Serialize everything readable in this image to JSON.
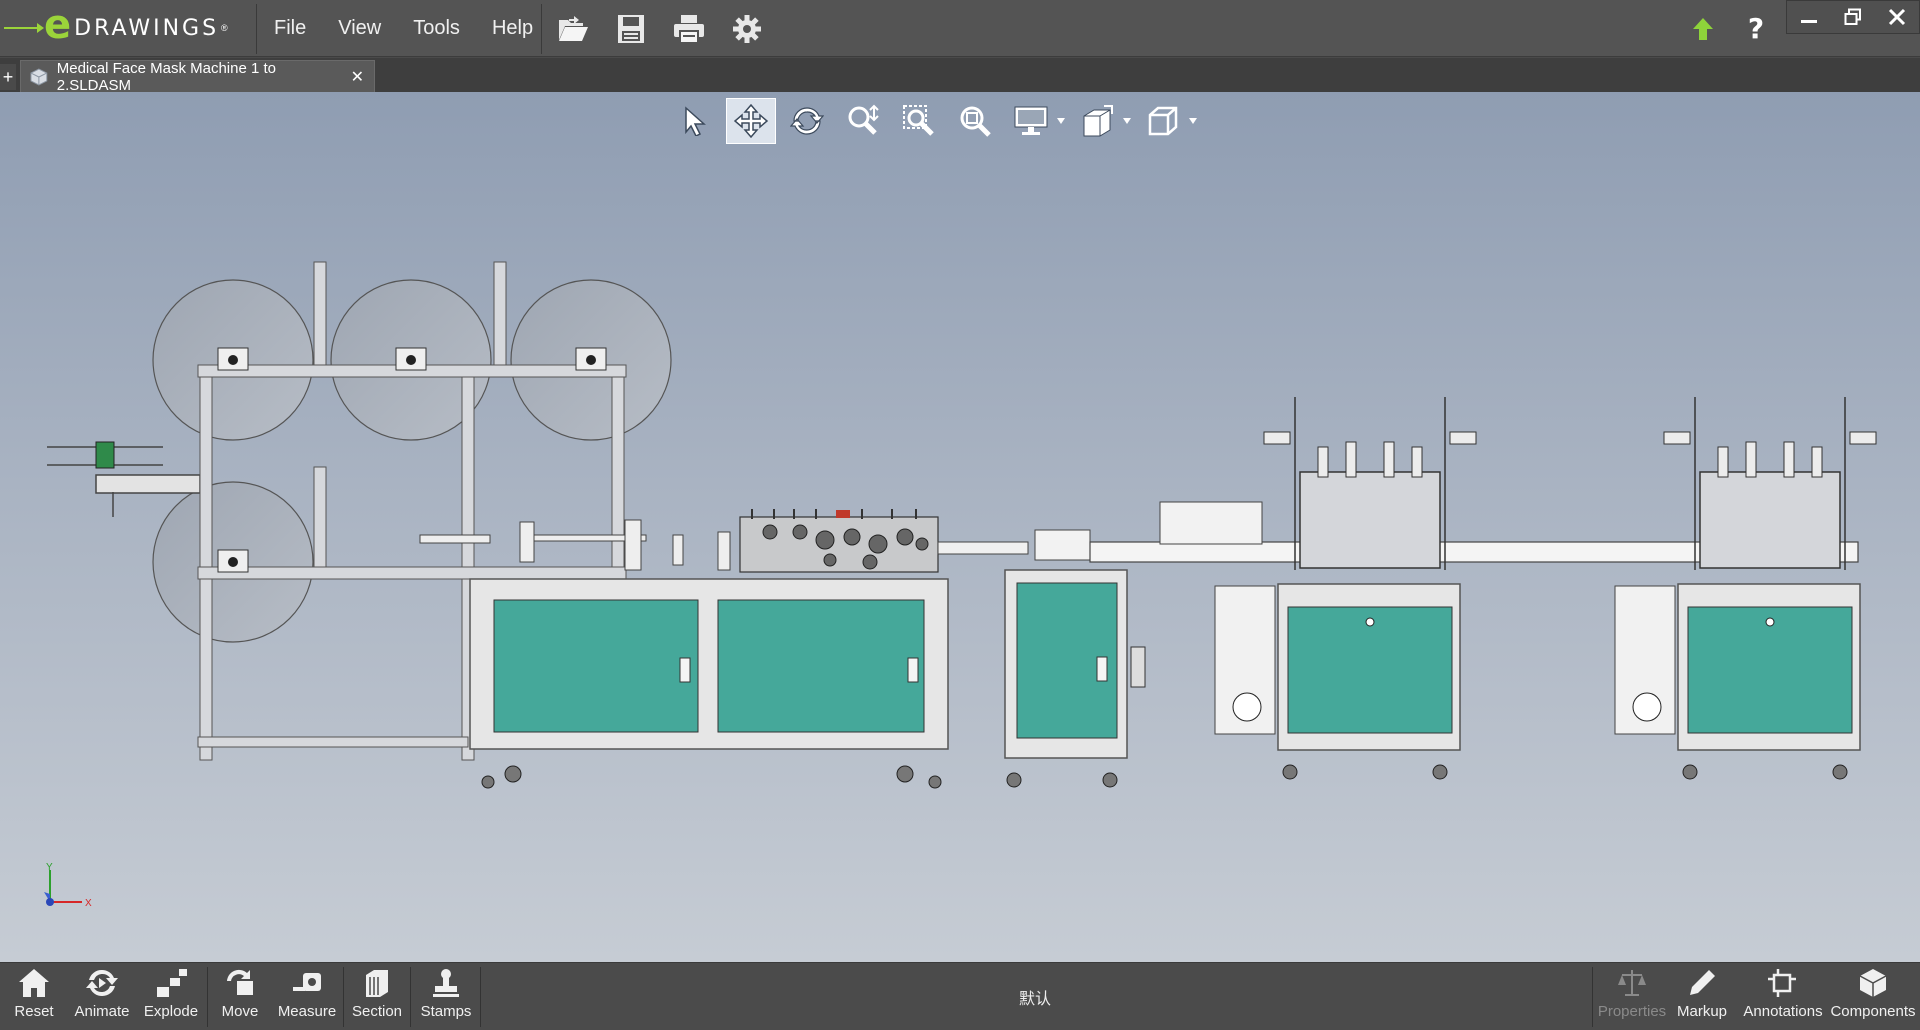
{
  "app": {
    "logo_e": "e",
    "logo_word": "DRAWINGS",
    "logo_reg": "®"
  },
  "menu": [
    "File",
    "View",
    "Tools",
    "Help"
  ],
  "file_toolbar": [
    "open-icon",
    "save-icon",
    "print-icon",
    "settings-icon"
  ],
  "window_controls": [
    "upload-icon",
    "help-icon",
    "minimize-icon",
    "restore-icon",
    "close-icon"
  ],
  "help_glyph": "?",
  "tab": {
    "add": "+",
    "title": "Medical Face Mask Machine 1 to 2.SLDASM",
    "close": "✕"
  },
  "view_toolbar": {
    "tools": [
      "select-icon",
      "pan-icon",
      "rotate-icon",
      "zoom-icon",
      "zoom-to-area-icon",
      "zoom-to-fit-icon",
      "display-style-icon",
      "view-orientation-icon",
      "standard-views-icon"
    ],
    "active": "pan-icon"
  },
  "triad": {
    "x": "X",
    "y": "Y"
  },
  "bottom_left": [
    {
      "label": "Reset",
      "icon": "home-icon"
    },
    {
      "label": "Animate",
      "icon": "animate-icon"
    },
    {
      "label": "Explode",
      "icon": "explode-icon"
    },
    {
      "label": "Move",
      "icon": "move-icon"
    },
    {
      "label": "Measure",
      "icon": "measure-icon"
    },
    {
      "label": "Section",
      "icon": "section-icon"
    },
    {
      "label": "Stamps",
      "icon": "stamps-icon"
    }
  ],
  "configuration": "默认",
  "bottom_right": [
    {
      "label": "Properties",
      "icon": "scales-icon"
    },
    {
      "label": "Markup",
      "icon": "pencil-icon"
    },
    {
      "label": "Annotations",
      "icon": "annotation-icon"
    },
    {
      "label": "Components",
      "icon": "components-icon"
    }
  ],
  "colors": {
    "accent": "#9bd43a",
    "panel": "#45a89a",
    "viewport_top": "#8f9db2",
    "viewport_bottom": "#c6ccd4"
  }
}
